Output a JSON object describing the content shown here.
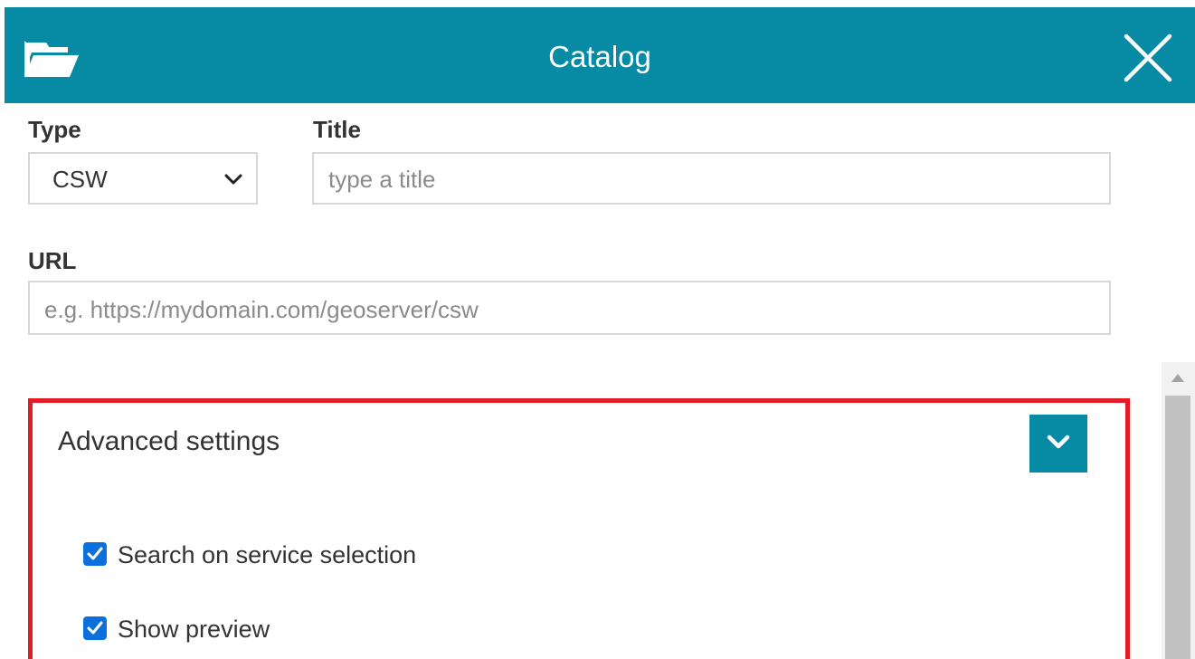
{
  "header": {
    "title": "Catalog",
    "background_color": "#078aa3",
    "left_icon": "folder-open-icon",
    "close_icon": "close-icon"
  },
  "form": {
    "type_label": "Type",
    "type_value": "CSW",
    "title_label": "Title",
    "title_placeholder": "type a title",
    "title_value": "",
    "url_label": "URL",
    "url_placeholder": "e.g. https://mydomain.com/geoserver/csw",
    "url_value": ""
  },
  "advanced": {
    "title": "Advanced settings",
    "highlight_color": "#e31d25",
    "toggle_icon": "chevron-down-icon",
    "options": [
      {
        "label": "Search on service selection",
        "checked": true
      },
      {
        "label": "Show preview",
        "checked": true
      }
    ],
    "checkbox_color": "#0b6fdc"
  },
  "scrollbar": {
    "up_icon": "scroll-up-arrow-icon"
  }
}
